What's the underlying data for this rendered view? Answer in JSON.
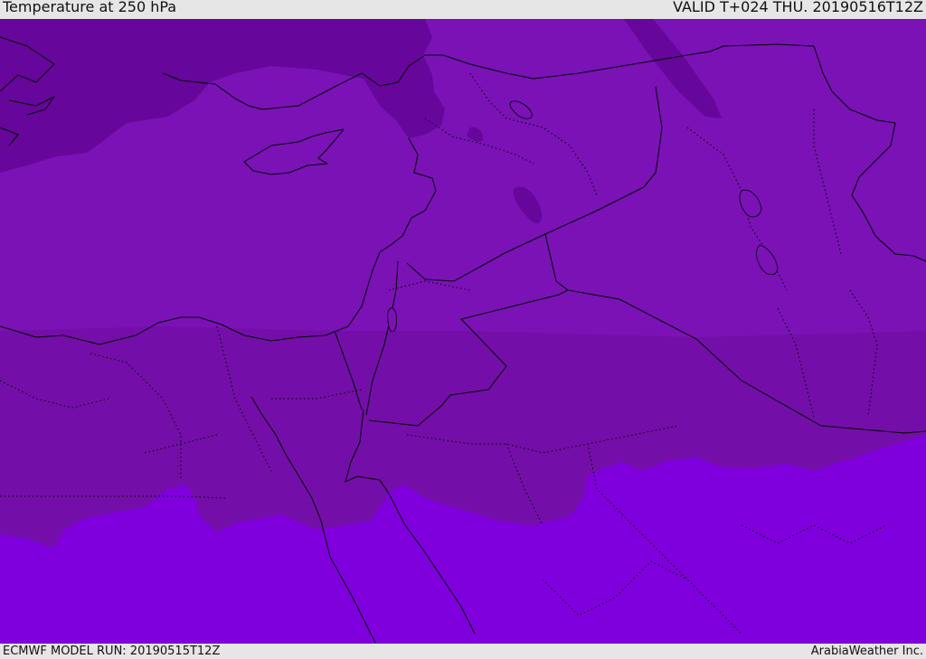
{
  "header": {
    "title": "Temperature at 250 hPa",
    "valid": "VALID T+024 THU. 20190516T12Z"
  },
  "footer": {
    "model_run": "ECMWF MODEL RUN: 20190515T12Z",
    "credit": "ArabiaWeather Inc."
  },
  "colors": {
    "coldest": "#66069a",
    "cold": "#7a12b6",
    "mid": "#730fa8",
    "warm": "#7f00dc",
    "bar_background": "#e6e6e6"
  }
}
